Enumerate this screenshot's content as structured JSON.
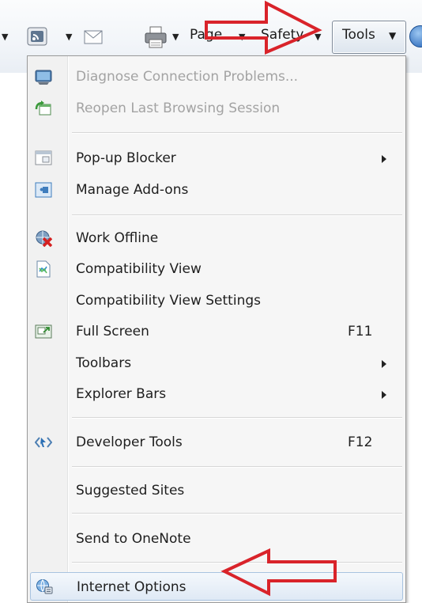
{
  "toolbar": {
    "page_label": "Page",
    "safety_label": "Safety",
    "tools_label": "Tools"
  },
  "menu": {
    "items": [
      {
        "label": "Diagnose Connection Problems...",
        "enabled": false,
        "icon": "diagnose-connection-icon"
      },
      {
        "label": "Reopen Last Browsing Session",
        "enabled": false,
        "icon": "reopen-session-icon"
      },
      {
        "label": "Pop-up Blocker",
        "submenu": true,
        "icon": "popup-blocker-icon"
      },
      {
        "label": "Manage Add-ons",
        "icon": "manage-addons-icon"
      },
      {
        "label": "Work Offline",
        "icon": "work-offline-icon"
      },
      {
        "label": "Compatibility View",
        "icon": "compatibility-view-icon"
      },
      {
        "label": "Compatibility View Settings"
      },
      {
        "label": "Full Screen",
        "shortcut": "F11",
        "icon": "full-screen-icon"
      },
      {
        "label": "Toolbars",
        "submenu": true
      },
      {
        "label": "Explorer Bars",
        "submenu": true
      },
      {
        "label": "Developer Tools",
        "shortcut": "F12",
        "icon": "developer-tools-icon"
      },
      {
        "label": "Suggested Sites"
      },
      {
        "label": "Send to OneNote"
      },
      {
        "label": "Internet Options",
        "icon": "internet-options-icon",
        "highlighted": true
      }
    ]
  },
  "colors": {
    "annotation_arrow": "#d9232a",
    "disabled_text": "#a3a3a3",
    "menu_background": "#f6f6f6"
  }
}
